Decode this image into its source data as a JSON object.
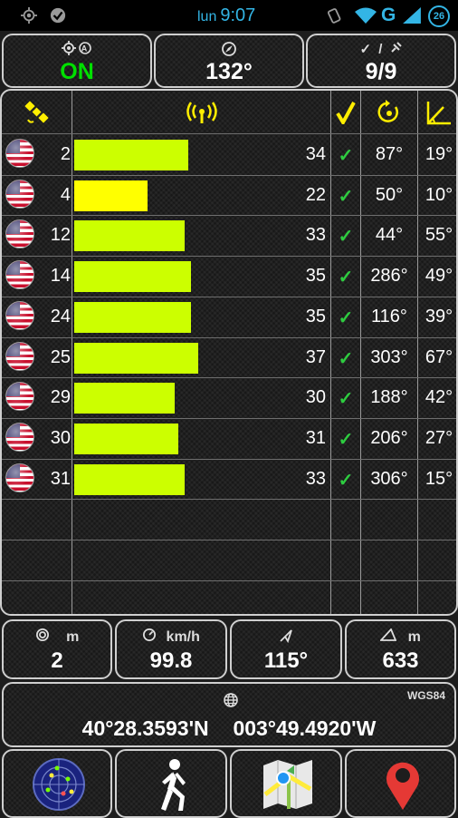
{
  "status_bar": {
    "day": "lun",
    "time": "9:07",
    "network": "G",
    "notification_count": "26"
  },
  "top_panels": {
    "gps_status": {
      "value": "ON",
      "icon": "gps-fix-icon"
    },
    "heading": {
      "value": "132°",
      "icon": "compass-icon"
    },
    "satellites": {
      "value": "9/9",
      "icon_label": "✓ / ",
      "icon": "satellite-used-icon"
    }
  },
  "table": {
    "headers": [
      "satellite",
      "signal",
      "used",
      "azimuth",
      "elevation"
    ],
    "rows": [
      {
        "prn": "2",
        "snr": "34",
        "snr_value": 34,
        "used": "✓",
        "azimuth": "87°",
        "elevation": "19°",
        "bar_color": "#ccff00"
      },
      {
        "prn": "4",
        "snr": "22",
        "snr_value": 22,
        "used": "✓",
        "azimuth": "50°",
        "elevation": "10°",
        "bar_color": "#ffff00"
      },
      {
        "prn": "12",
        "snr": "33",
        "snr_value": 33,
        "used": "✓",
        "azimuth": "44°",
        "elevation": "55°",
        "bar_color": "#ccff00"
      },
      {
        "prn": "14",
        "snr": "35",
        "snr_value": 35,
        "used": "✓",
        "azimuth": "286°",
        "elevation": "49°",
        "bar_color": "#ccff00"
      },
      {
        "prn": "24",
        "snr": "35",
        "snr_value": 35,
        "used": "✓",
        "azimuth": "116°",
        "elevation": "39°",
        "bar_color": "#ccff00"
      },
      {
        "prn": "25",
        "snr": "37",
        "snr_value": 37,
        "used": "✓",
        "azimuth": "303°",
        "elevation": "67°",
        "bar_color": "#ccff00"
      },
      {
        "prn": "29",
        "snr": "30",
        "snr_value": 30,
        "used": "✓",
        "azimuth": "188°",
        "elevation": "42°",
        "bar_color": "#ccff00"
      },
      {
        "prn": "30",
        "snr": "31",
        "snr_value": 31,
        "used": "✓",
        "azimuth": "206°",
        "elevation": "27°",
        "bar_color": "#ccff00"
      },
      {
        "prn": "31",
        "snr": "33",
        "snr_value": 33,
        "used": "✓",
        "azimuth": "306°",
        "elevation": "15°",
        "bar_color": "#ccff00"
      }
    ],
    "snr_max": 50
  },
  "bottom_panels": {
    "accuracy": {
      "unit": "m",
      "value": "2"
    },
    "speed": {
      "unit": "km/h",
      "value": "99.8"
    },
    "bearing": {
      "value": "115°"
    },
    "altitude": {
      "unit": "m",
      "value": "633"
    }
  },
  "coordinates": {
    "datum": "WGS84",
    "latitude": "40°28.3593'N",
    "longitude": "003°49.4920'W"
  },
  "colors": {
    "accent_green": "#00e000",
    "check_green": "#2ecc40",
    "bar_normal": "#ccff00",
    "bar_weak": "#ffff00",
    "header_yellow": "#ffee00",
    "status_blue": "#33b5e5"
  }
}
